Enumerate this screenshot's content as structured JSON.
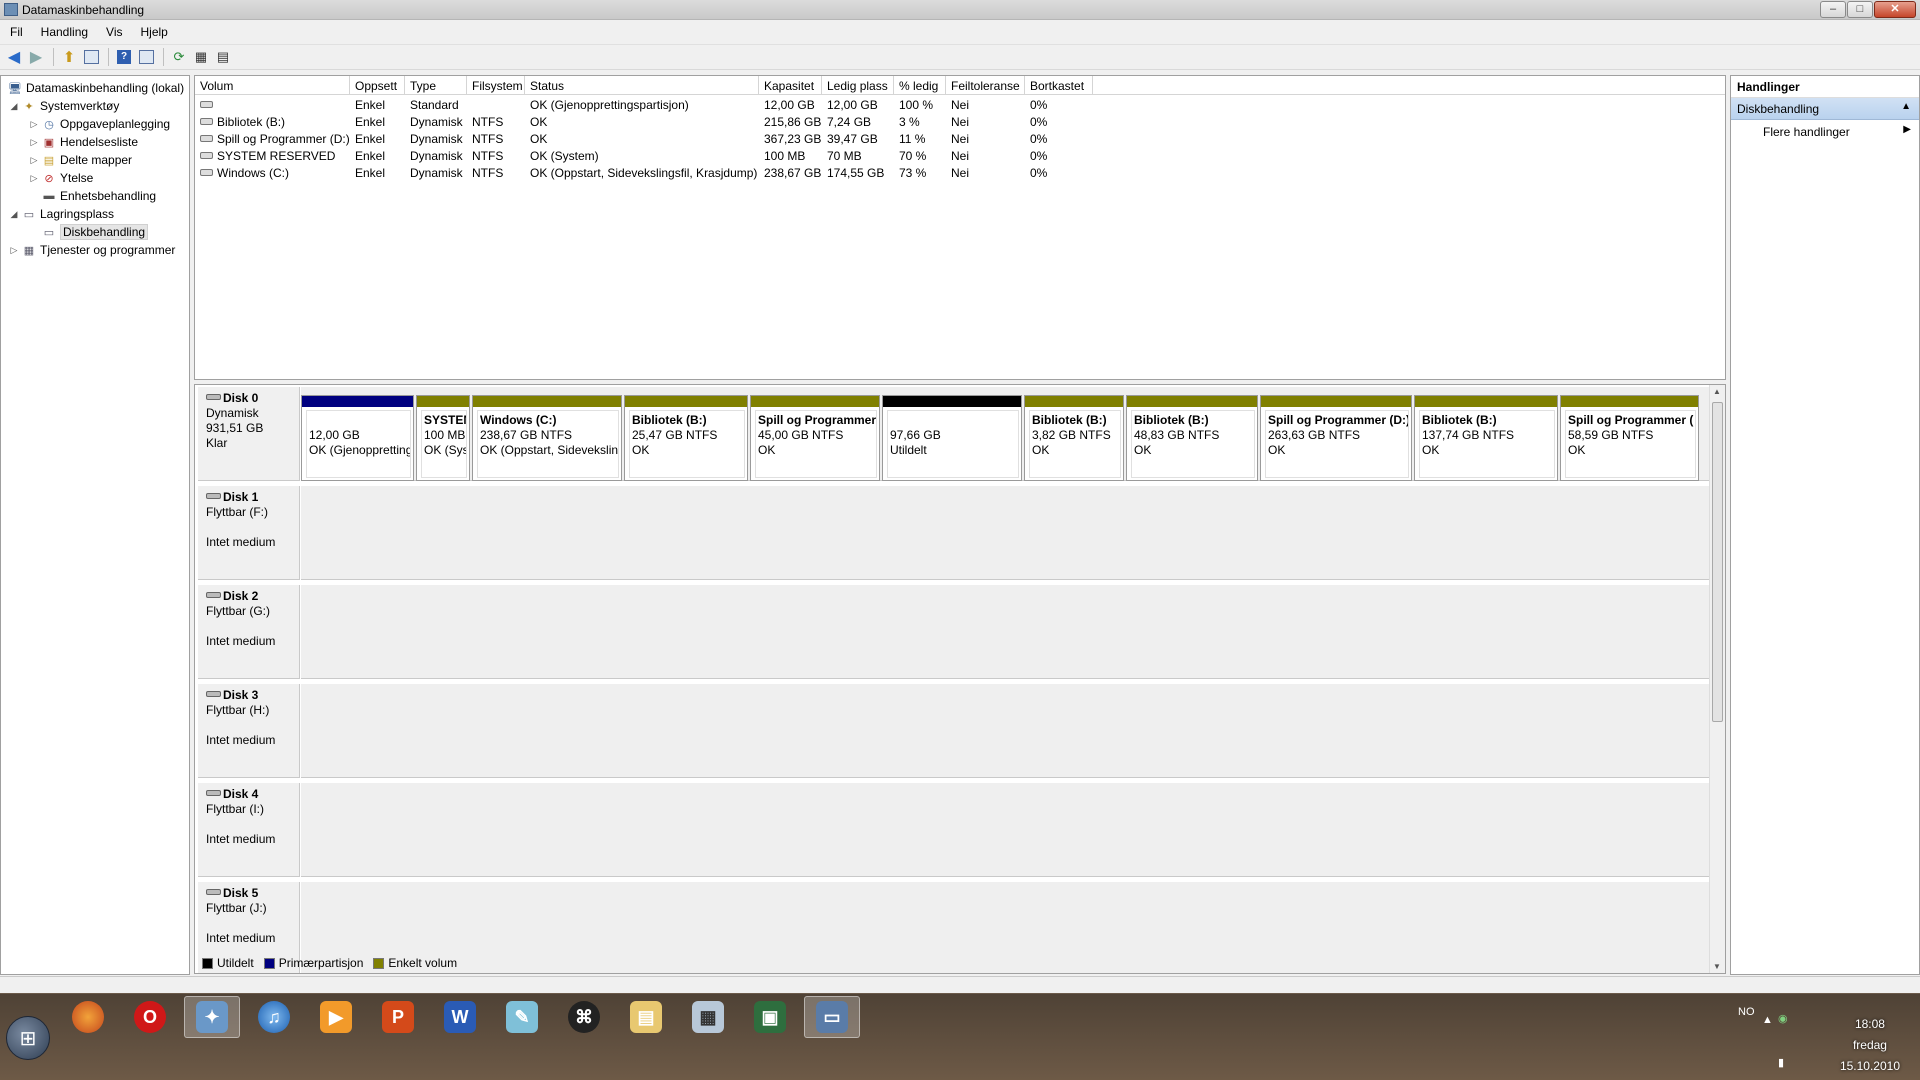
{
  "window": {
    "title": "Datamaskinbehandling",
    "buttons": {
      "minimize": "–",
      "maximize": "□",
      "close": "✕"
    }
  },
  "menu": [
    "Fil",
    "Handling",
    "Vis",
    "Hjelp"
  ],
  "toolbar": [
    "back-icon",
    "forward-icon",
    "up-icon",
    "show-hide-tree-icon",
    "help-icon",
    "show-hide-action-icon",
    "refresh-icon",
    "properties-icon",
    "export-icon"
  ],
  "tree": {
    "root": "Datamaskinbehandling (lokal)",
    "systemverktoy": "Systemverktøy",
    "oppgaveplanlegging": "Oppgaveplanlegging",
    "hendelseslogg": "Hendelsesliste",
    "delte_mapper": "Delte mapper",
    "ytelse": "Ytelse",
    "enhetsbehandling": "Enhetsbehandling",
    "lagringsplass": "Lagringsplass",
    "diskbehandling": "Diskbehandling",
    "tjenester": "Tjenester og programmer"
  },
  "volume_list": {
    "columns": [
      "Volum",
      "Oppsett",
      "Type",
      "Filsystem",
      "Status",
      "Kapasitet",
      "Ledig plass",
      "% ledig",
      "Feiltoleranse",
      "Bortkastet"
    ],
    "rows": [
      [
        "",
        "Enkel",
        "Standard",
        "",
        "OK (Gjenopprettingspartisjon)",
        "12,00 GB",
        "12,00 GB",
        "100 %",
        "Nei",
        "0%"
      ],
      [
        "Bibliotek (B:)",
        "Enkel",
        "Dynamisk",
        "NTFS",
        "OK",
        "215,86 GB",
        "7,24 GB",
        "3 %",
        "Nei",
        "0%"
      ],
      [
        "Spill og Programmer (D:)",
        "Enkel",
        "Dynamisk",
        "NTFS",
        "OK",
        "367,23 GB",
        "39,47 GB",
        "11 %",
        "Nei",
        "0%"
      ],
      [
        "SYSTEM RESERVED",
        "Enkel",
        "Dynamisk",
        "NTFS",
        "OK (System)",
        "100 MB",
        "70 MB",
        "70 %",
        "Nei",
        "0%"
      ],
      [
        "Windows (C:)",
        "Enkel",
        "Dynamisk",
        "NTFS",
        "OK (Oppstart, Sidevekslingsfil, Krasjdump)",
        "238,67 GB",
        "174,55 GB",
        "73 %",
        "Nei",
        "0%"
      ]
    ]
  },
  "disks": [
    {
      "name": "Disk 0",
      "line1": "Dynamisk",
      "line2": "931,51 GB",
      "line3": "Klar",
      "partitions": [
        {
          "name": "",
          "size": "12,00 GB",
          "status": "OK (Gjenopprettingspartisjon)",
          "color": "#00007f"
        },
        {
          "name": "SYSTEM RESERVED",
          "size": "100 MB",
          "status": "OK (System)",
          "color": "#808000"
        },
        {
          "name": "Windows  (C:)",
          "size": "238,67 GB NTFS",
          "status": "OK (Oppstart, Sidevekslingsfil, Krasjdump)",
          "color": "#808000"
        },
        {
          "name": "Bibliotek  (B:)",
          "size": "25,47 GB NTFS",
          "status": "OK",
          "color": "#808000"
        },
        {
          "name": "Spill og Programmer",
          "size": "45,00 GB NTFS",
          "status": "OK",
          "color": "#808000"
        },
        {
          "name": "",
          "size": "97,66 GB",
          "status": "Utildelt",
          "color": "#000000"
        },
        {
          "name": "Bibliotek  (B:)",
          "size": "3,82 GB NTFS",
          "status": "OK",
          "color": "#808000"
        },
        {
          "name": "Bibliotek  (B:)",
          "size": "48,83 GB NTFS",
          "status": "OK",
          "color": "#808000"
        },
        {
          "name": "Spill og Programmer  (D:)",
          "size": "263,63 GB NTFS",
          "status": "OK",
          "color": "#808000"
        },
        {
          "name": "Bibliotek  (B:)",
          "size": "137,74 GB NTFS",
          "status": "OK",
          "color": "#808000"
        },
        {
          "name": "Spill og Programmer  (",
          "size": "58,59 GB NTFS",
          "status": "OK",
          "color": "#808000"
        }
      ]
    },
    {
      "name": "Disk 1",
      "line1": "Flyttbar (F:)",
      "line2": "",
      "line3": "Intet medium"
    },
    {
      "name": "Disk 2",
      "line1": "Flyttbar (G:)",
      "line2": "",
      "line3": "Intet medium"
    },
    {
      "name": "Disk 3",
      "line1": "Flyttbar (H:)",
      "line2": "",
      "line3": "Intet medium"
    },
    {
      "name": "Disk 4",
      "line1": "Flyttbar (I:)",
      "line2": "",
      "line3": "Intet medium"
    },
    {
      "name": "Disk 5",
      "line1": "Flyttbar (J:)",
      "line2": "",
      "line3": "Intet medium"
    }
  ],
  "legend": [
    {
      "label": "Utildelt",
      "color": "#000000"
    },
    {
      "label": "Primærpartisjon",
      "color": "#00007f"
    },
    {
      "label": "Enkelt volum",
      "color": "#808000"
    }
  ],
  "actions": {
    "title": "Handlinger",
    "section": "Diskbehandling",
    "more": "Flere handlinger"
  },
  "taskbar": {
    "apps": [
      "Firefox",
      "Opera",
      "Steam",
      "iTunes",
      "Media Player",
      "PowerPoint",
      "Word",
      "Notepad",
      "Terminal",
      "Explorer",
      "Calculator",
      "Task Manager",
      "Computer Management"
    ],
    "lang": "NO",
    "time": "18:08",
    "day": "fredag",
    "date": "15.10.2010"
  }
}
